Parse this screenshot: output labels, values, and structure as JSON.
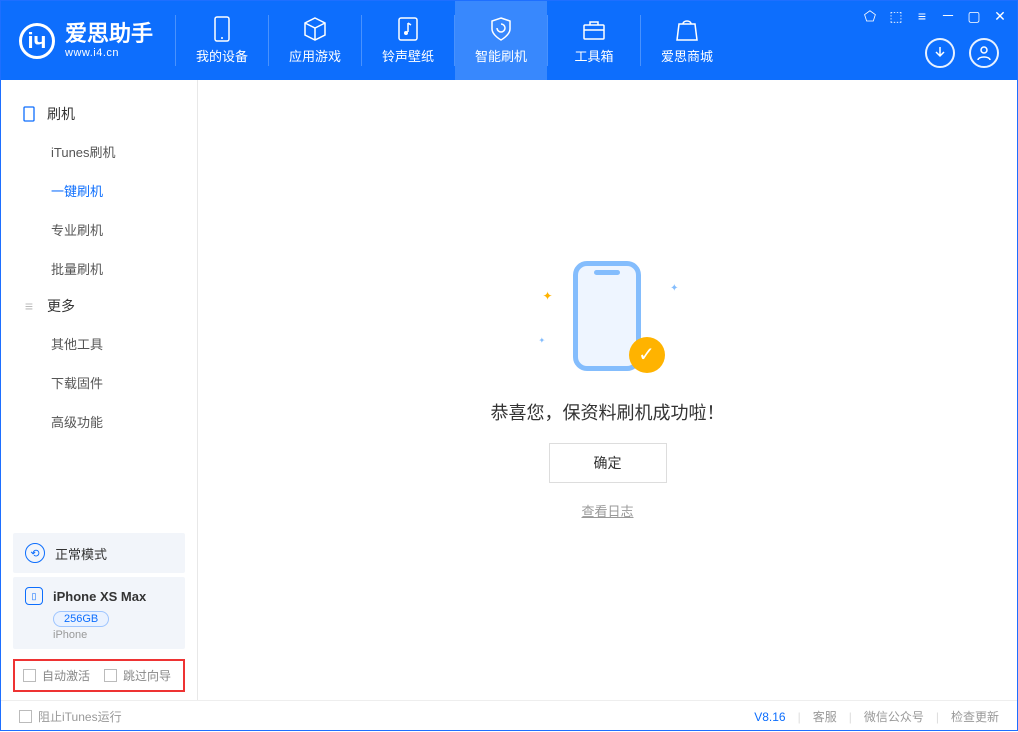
{
  "app": {
    "title": "爱思助手",
    "subtitle": "www.i4.cn"
  },
  "tabs": [
    {
      "label": "我的设备",
      "icon": "device"
    },
    {
      "label": "应用游戏",
      "icon": "cube"
    },
    {
      "label": "铃声壁纸",
      "icon": "music"
    },
    {
      "label": "智能刷机",
      "icon": "shield",
      "active": true
    },
    {
      "label": "工具箱",
      "icon": "toolbox"
    },
    {
      "label": "爱思商城",
      "icon": "bag"
    }
  ],
  "sidebar": {
    "group1": {
      "title": "刷机",
      "items": [
        "iTunes刷机",
        "一键刷机",
        "专业刷机",
        "批量刷机"
      ],
      "active_index": 1
    },
    "group2": {
      "title": "更多",
      "items": [
        "其他工具",
        "下载固件",
        "高级功能"
      ]
    }
  },
  "mode": {
    "label": "正常模式"
  },
  "device": {
    "name": "iPhone XS Max",
    "storage": "256GB",
    "type": "iPhone"
  },
  "options": {
    "auto_activate": "自动激活",
    "skip_guide": "跳过向导"
  },
  "main": {
    "success_text": "恭喜您，保资料刷机成功啦！",
    "ok_button": "确定",
    "view_log": "查看日志"
  },
  "footer": {
    "block_itunes": "阻止iTunes运行",
    "version": "V8.16",
    "links": [
      "客服",
      "微信公众号",
      "检查更新"
    ]
  }
}
